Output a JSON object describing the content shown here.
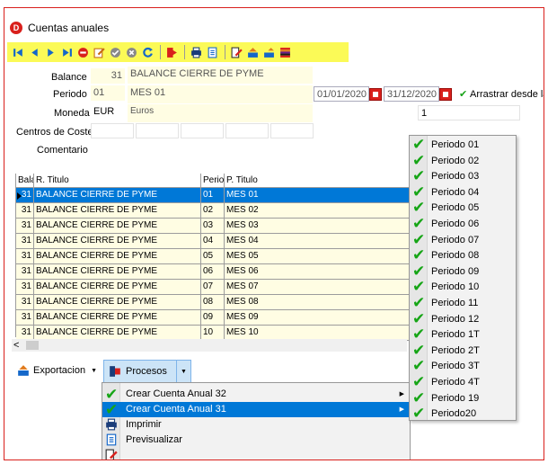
{
  "window": {
    "title": "Cuentas anuales",
    "app_icon_letter": "D",
    "border_color": "#d9201c"
  },
  "toolbar": {
    "icons": [
      "first-icon",
      "prev-icon",
      "next-icon",
      "last-icon",
      "delete-icon",
      "edit-icon",
      "confirm-icon",
      "cancel-icon",
      "refresh-icon",
      "exit-icon",
      "print-icon",
      "preview-icon",
      "report-icon",
      "upload-icon",
      "upload2-icon",
      "palette-icon"
    ],
    "bg_color": "#fbfa57"
  },
  "form": {
    "balance_label": "Balance",
    "balance_code": "31",
    "balance_name": "BALANCE CIERRE DE PYME",
    "periodo_label": "Periodo",
    "periodo_code": "01",
    "periodo_name": "MES 01",
    "date_from": "01/01/2020",
    "date_to": "31/12/2020",
    "arrastrar_label": "Arrastrar desde la",
    "moneda_label": "Moneda",
    "moneda_code": "EUR",
    "moneda_name": "Euros",
    "extra_value": "1",
    "centros_label": "Centros de Coste",
    "comentario_label": "Comentario"
  },
  "grid": {
    "headers": [
      "Bala",
      "R. Titulo",
      "Perio",
      "P. Titulo"
    ],
    "rows": [
      [
        "31",
        "BALANCE CIERRE DE PYME",
        "01",
        "MES 01"
      ],
      [
        "31",
        "BALANCE CIERRE DE PYME",
        "02",
        "MES 02"
      ],
      [
        "31",
        "BALANCE CIERRE DE PYME",
        "03",
        "MES 03"
      ],
      [
        "31",
        "BALANCE CIERRE DE PYME",
        "04",
        "MES 04"
      ],
      [
        "31",
        "BALANCE CIERRE DE PYME",
        "05",
        "MES 05"
      ],
      [
        "31",
        "BALANCE CIERRE DE PYME",
        "06",
        "MES 06"
      ],
      [
        "31",
        "BALANCE CIERRE DE PYME",
        "07",
        "MES 07"
      ],
      [
        "31",
        "BALANCE CIERRE DE PYME",
        "08",
        "MES 08"
      ],
      [
        "31",
        "BALANCE CIERRE DE PYME",
        "09",
        "MES 09"
      ],
      [
        "31",
        "BALANCE CIERRE DE PYME",
        "10",
        "MES 10"
      ]
    ],
    "selected_row": 0,
    "selection_color": "#0078d7",
    "row_color": "#fffde3"
  },
  "bottom": {
    "export_label": "Exportacion",
    "procesos_label": "Procesos"
  },
  "proc_menu": {
    "items": [
      {
        "label": "Crear Cuenta Anual 32",
        "icon": "check-icon",
        "has_submenu": true,
        "highlighted": false
      },
      {
        "label": "Crear Cuenta Anual 31",
        "icon": "check-icon",
        "has_submenu": true,
        "highlighted": true
      },
      {
        "label": "Imprimir",
        "icon": "print-icon",
        "has_submenu": false,
        "highlighted": false
      },
      {
        "label": "Previsualizar",
        "icon": "preview-icon",
        "has_submenu": false,
        "highlighted": false
      },
      {
        "label": "",
        "icon": "report-icon",
        "has_submenu": false,
        "highlighted": false
      }
    ]
  },
  "period_menu": {
    "items": [
      "Periodo 01",
      "Periodo 02",
      "Periodo 03",
      "Periodo 04",
      "Periodo 05",
      "Periodo 06",
      "Periodo 07",
      "Periodo 08",
      "Periodo 09",
      "Periodo 10",
      "Periodo 11",
      "Periodo 12",
      "Periodo 1T",
      "Periodo 2T",
      "Periodo 3T",
      "Periodo 4T",
      "Periodo 19",
      "Periodo20"
    ],
    "check_color": "#16a516"
  }
}
